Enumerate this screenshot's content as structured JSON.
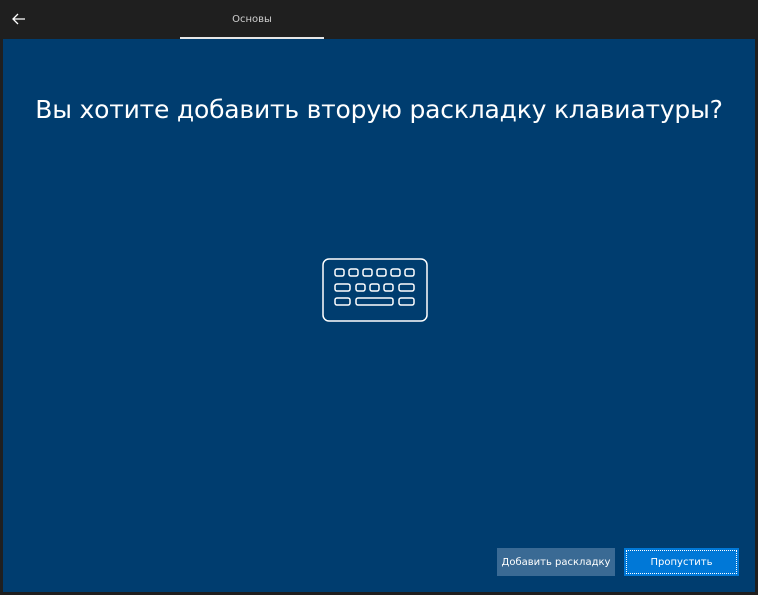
{
  "header": {
    "back_icon": "arrow-left-icon",
    "tab_label": "Основы"
  },
  "main": {
    "title": "Вы хотите добавить вторую раскладку клавиатуры?",
    "illustration_icon": "keyboard-icon"
  },
  "buttons": {
    "add_label": "Добавить раскладку",
    "skip_label": "Пропустить"
  },
  "colors": {
    "background": "#003d6f",
    "topbar": "#1f1f1f",
    "primary_button": "#0078d7",
    "secondary_button": "#3a6a94"
  }
}
